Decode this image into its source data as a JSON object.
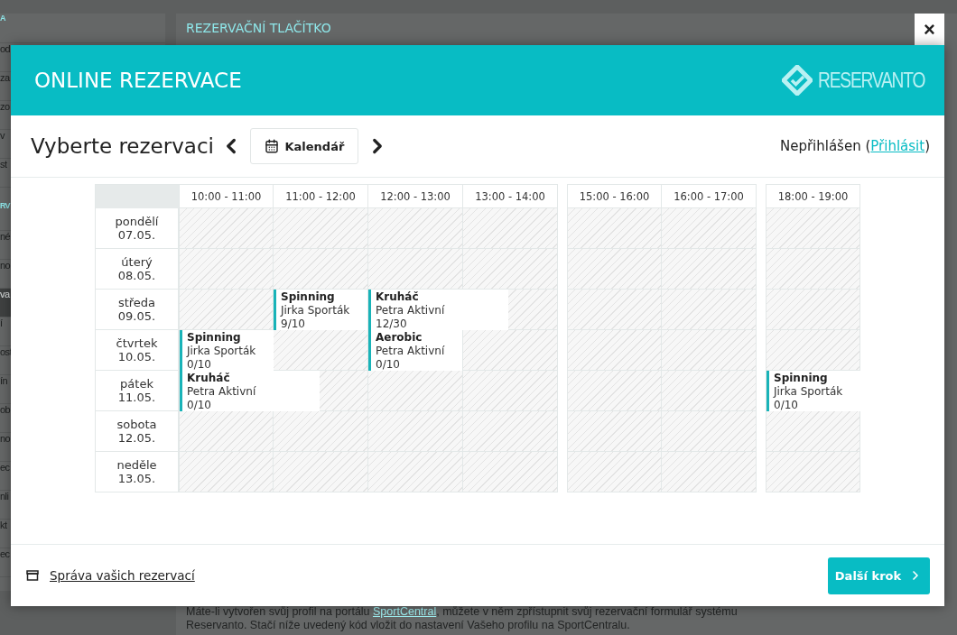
{
  "background_page": {
    "sidebar": {
      "sections": [
        {
          "heading": "A",
          "items": [
            {
              "label": "od",
              "selected": false
            },
            {
              "label": "za",
              "selected": false
            },
            {
              "label": "zo",
              "selected": false
            },
            {
              "label": "v",
              "selected": false
            },
            {
              "label": "st",
              "selected": false
            }
          ]
        },
        {
          "heading": "RV",
          "items": [
            {
              "label": "né",
              "selected": false
            },
            {
              "label": "no",
              "selected": false
            },
            {
              "label": "va",
              "selected": true
            },
            {
              "label": "í",
              "selected": false
            },
            {
              "label": "ost",
              "selected": false
            },
            {
              "label": "ín",
              "selected": false
            },
            {
              "label": "ob",
              "selected": false
            },
            {
              "label": "no",
              "selected": false
            },
            {
              "label": "ec",
              "selected": false
            },
            {
              "label": "nli",
              "selected": false
            },
            {
              "label": "kt",
              "selected": false
            },
            {
              "label": "ec",
              "selected": false
            }
          ]
        }
      ]
    },
    "main": {
      "heading": "REZERVAČNÍ TLAČÍTKO",
      "paragraph": {
        "before": "Máte-li vytvořen svůj profil na portálu ",
        "link": "SportCentral",
        "after": ", můžete v něm zpřístupnit svůj rezervační formulář systému Reservanto. Stačí níže uvedený kód vložit do nastavení Vašeho profilu na SportCentralu."
      }
    }
  },
  "modal": {
    "close": "×",
    "title": "ONLINE REZERVACE",
    "logo_text": "RESERVANTO",
    "heading": "Vyberte rezervaci",
    "view_button": "Kalendář",
    "login_status": {
      "before": "Nepřihlášen (",
      "link": "Přihlásit",
      "after": ")"
    },
    "calendar": {
      "columns": [
        {
          "label": "10:00 - 11:00",
          "break_before": false
        },
        {
          "label": "11:00 - 12:00",
          "break_before": false
        },
        {
          "label": "12:00 - 13:00",
          "break_before": false
        },
        {
          "label": "13:00 - 14:00",
          "break_before": false
        },
        {
          "label": "15:00 - 16:00",
          "break_before": true
        },
        {
          "label": "16:00 - 17:00",
          "break_before": false
        },
        {
          "label": "18:00 - 19:00",
          "break_before": true
        }
      ],
      "rows": [
        {
          "day": "pondělí",
          "date": "07.05.",
          "cells": [
            {
              "kind": "free"
            },
            {
              "kind": "free"
            },
            {
              "kind": "free"
            },
            {
              "kind": "free"
            },
            {
              "kind": "free"
            },
            {
              "kind": "free"
            },
            {
              "kind": "free"
            }
          ]
        },
        {
          "day": "úterý",
          "date": "08.05.",
          "cells": [
            {
              "kind": "free"
            },
            {
              "kind": "free"
            },
            {
              "kind": "free"
            },
            {
              "kind": "free"
            },
            {
              "kind": "free"
            },
            {
              "kind": "free"
            },
            {
              "kind": "free"
            }
          ]
        },
        {
          "day": "středa",
          "date": "09.05.",
          "cells": [
            {
              "kind": "free"
            },
            {
              "kind": "event",
              "title": "Spinning",
              "trainer": "Jirka Sporták",
              "capacity": "9/10"
            },
            {
              "kind": "event_wide",
              "title": "Kruháč",
              "trainer": "Petra Aktivní",
              "capacity": "12/30"
            },
            {
              "kind": "free"
            },
            {
              "kind": "free"
            },
            {
              "kind": "free"
            },
            {
              "kind": "free"
            }
          ]
        },
        {
          "day": "čtvrtek",
          "date": "10.05.",
          "cells": [
            {
              "kind": "event",
              "title": "Spinning",
              "trainer": "Jirka Sporták",
              "capacity": "0/10"
            },
            {
              "kind": "free"
            },
            {
              "kind": "event",
              "title": "Aerobic",
              "trainer": "Petra Aktivní",
              "capacity": "0/10"
            },
            {
              "kind": "free"
            },
            {
              "kind": "free"
            },
            {
              "kind": "free"
            },
            {
              "kind": "free"
            }
          ]
        },
        {
          "day": "pátek",
          "date": "11.05.",
          "cells": [
            {
              "kind": "event_wide",
              "title": "Kruháč",
              "trainer": "Petra Aktivní",
              "capacity": "0/10"
            },
            {
              "kind": "free"
            },
            {
              "kind": "free"
            },
            {
              "kind": "free"
            },
            {
              "kind": "free"
            },
            {
              "kind": "free"
            },
            {
              "kind": "event",
              "title": "Spinning",
              "trainer": "Jirka Sporták",
              "capacity": "0/10"
            }
          ]
        },
        {
          "day": "sobota",
          "date": "12.05.",
          "cells": [
            {
              "kind": "free"
            },
            {
              "kind": "free"
            },
            {
              "kind": "free"
            },
            {
              "kind": "free"
            },
            {
              "kind": "free"
            },
            {
              "kind": "free"
            },
            {
              "kind": "free"
            }
          ]
        },
        {
          "day": "neděle",
          "date": "13.05.",
          "cells": [
            {
              "kind": "free"
            },
            {
              "kind": "free"
            },
            {
              "kind": "free"
            },
            {
              "kind": "free"
            },
            {
              "kind": "free"
            },
            {
              "kind": "free"
            },
            {
              "kind": "free"
            }
          ]
        }
      ]
    },
    "manage_link": "Správa vašich rezervací",
    "next_button": "Další krok"
  }
}
